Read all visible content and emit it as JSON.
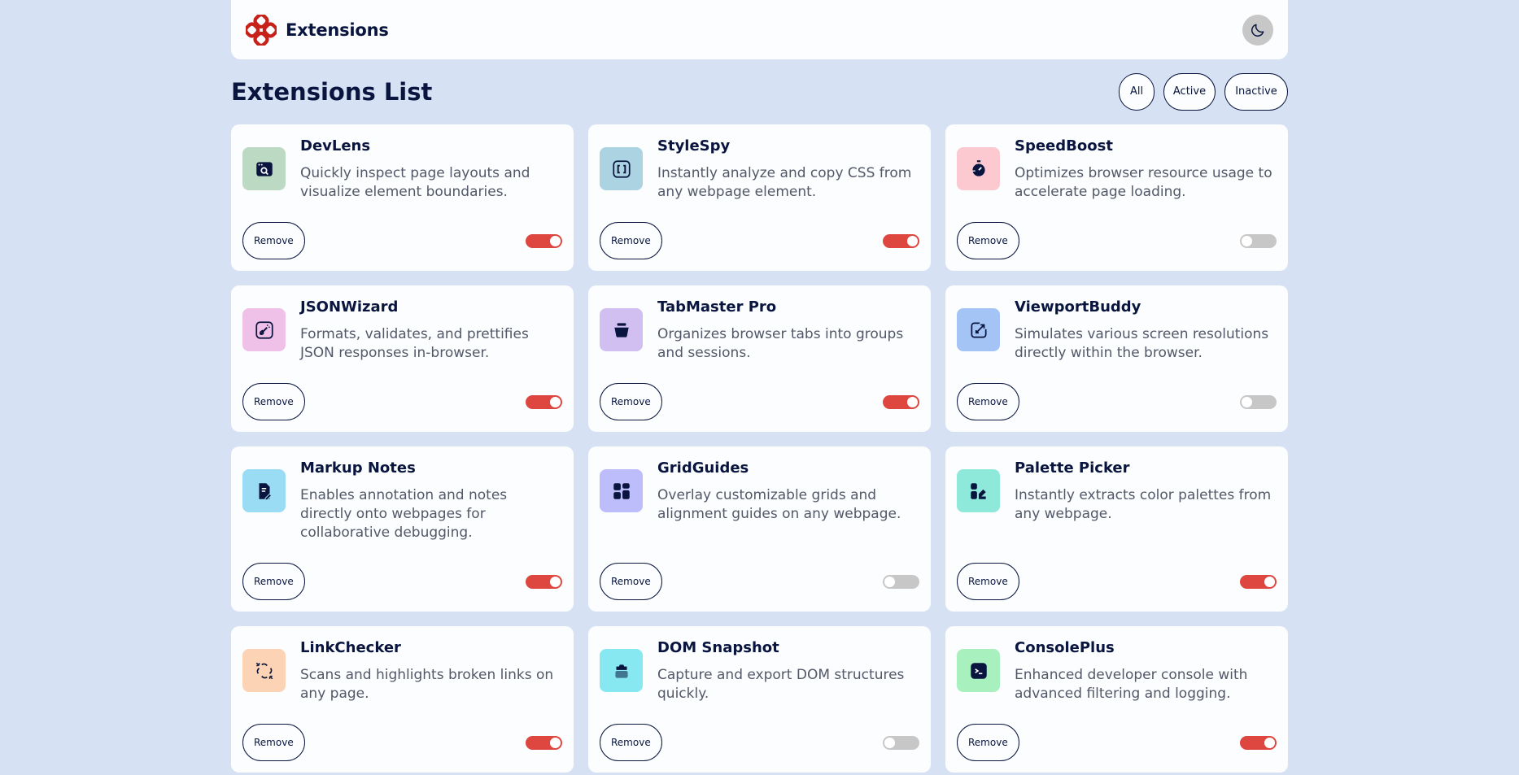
{
  "app": {
    "title": "Extensions"
  },
  "list": {
    "title": "Extensions List"
  },
  "filters": [
    "All",
    "Active",
    "Inactive"
  ],
  "colors": {
    "accent": "#de473f",
    "toggle_off": "#c7c7c7",
    "navy": "#09153e"
  },
  "extensions": [
    {
      "name": "DevLens",
      "description": "Quickly inspect page layouts and visualize element boundaries.",
      "active": true,
      "icon": "browser-search-icon",
      "icon_bg": "#bcd9c3",
      "remove_label": "Remove"
    },
    {
      "name": "StyleSpy",
      "description": "Instantly analyze and copy CSS from any webpage element.",
      "active": true,
      "icon": "css-brackets-icon",
      "icon_bg": "#acd3e2",
      "remove_label": "Remove"
    },
    {
      "name": "SpeedBoost",
      "description": "Optimizes browser resource usage to accelerate page loading.",
      "active": false,
      "icon": "stopwatch-icon",
      "icon_bg": "#fbc9cf",
      "remove_label": "Remove"
    },
    {
      "name": "JSONWizard",
      "description": "Formats, validates, and prettifies JSON responses in-browser.",
      "active": true,
      "icon": "magic-wand-icon",
      "icon_bg": "#f0c1e8",
      "remove_label": "Remove"
    },
    {
      "name": "TabMaster Pro",
      "description": "Organizes browser tabs into groups and sessions.",
      "active": true,
      "icon": "tab-box-icon",
      "icon_bg": "#d2bff2",
      "remove_label": "Remove"
    },
    {
      "name": "ViewportBuddy",
      "description": "Simulates various screen resolutions directly within the browser.",
      "active": false,
      "icon": "resize-arrow-icon",
      "icon_bg": "#a3c4f5",
      "remove_label": "Remove"
    },
    {
      "name": "Markup Notes",
      "description": "Enables annotation and notes directly onto webpages for collaborative debugging.",
      "active": true,
      "icon": "note-pen-icon",
      "icon_bg": "#99dcf3",
      "remove_label": "Remove"
    },
    {
      "name": "GridGuides",
      "description": "Overlay customizable grids and alignment guides on any webpage.",
      "active": false,
      "icon": "grid-icon",
      "icon_bg": "#bcbdfa",
      "remove_label": "Remove"
    },
    {
      "name": "Palette Picker",
      "description": "Instantly extracts color palettes from any webpage.",
      "active": true,
      "icon": "palette-icon",
      "icon_bg": "#8ee9da",
      "remove_label": "Remove"
    },
    {
      "name": "LinkChecker",
      "description": "Scans and highlights broken links on any page.",
      "active": true,
      "icon": "broken-link-icon",
      "icon_bg": "#fcd4b5",
      "remove_label": "Remove"
    },
    {
      "name": "DOM Snapshot",
      "description": "Capture and export DOM structures quickly.",
      "active": false,
      "icon": "camera-icon",
      "icon_bg": "#87e8f2",
      "remove_label": "Remove"
    },
    {
      "name": "ConsolePlus",
      "description": "Enhanced developer console with advanced filtering and logging.",
      "active": true,
      "icon": "terminal-icon",
      "icon_bg": "#a8f0bd",
      "remove_label": "Remove"
    }
  ]
}
